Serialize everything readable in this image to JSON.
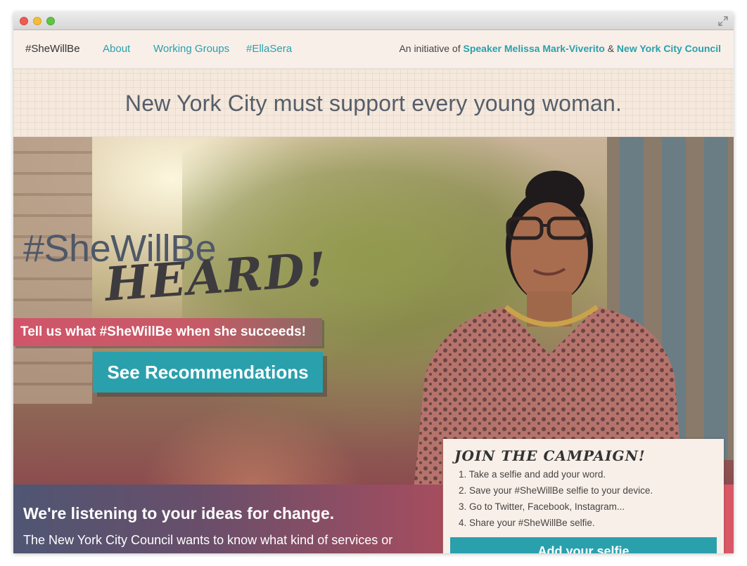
{
  "nav": {
    "brand": "#SheWillBe",
    "links": [
      "About",
      "Working Groups",
      "#EllaSera"
    ],
    "initiative_prefix": "An initiative of",
    "speaker": "Speaker Melissa Mark-Viverito",
    "amp": "&",
    "council": "New York City Council"
  },
  "banner": {
    "text": "New York City must support every young woman."
  },
  "hero": {
    "title_small": "#SheWillBe",
    "title_big": "HEARD!",
    "tell_us": "Tell us what #SheWillBe when she succeeds!",
    "button": "See Recommendations"
  },
  "listening": {
    "heading": "We're listening to your ideas for change.",
    "body": "The New York City Council wants to know what kind of services or"
  },
  "campaign": {
    "heading": "Join the campaign!",
    "steps": [
      "1. Take a selfie and add your word.",
      "2. Save your #SheWillBe selfie to your device.",
      "3. Go to Twitter, Facebook, Instagram...",
      "4. Share your #SheWillBe selfie."
    ],
    "button": "Add your selfie"
  },
  "colors": {
    "accent": "#2aa0ad",
    "coral": "#d1556a",
    "text": "#555e6a"
  }
}
